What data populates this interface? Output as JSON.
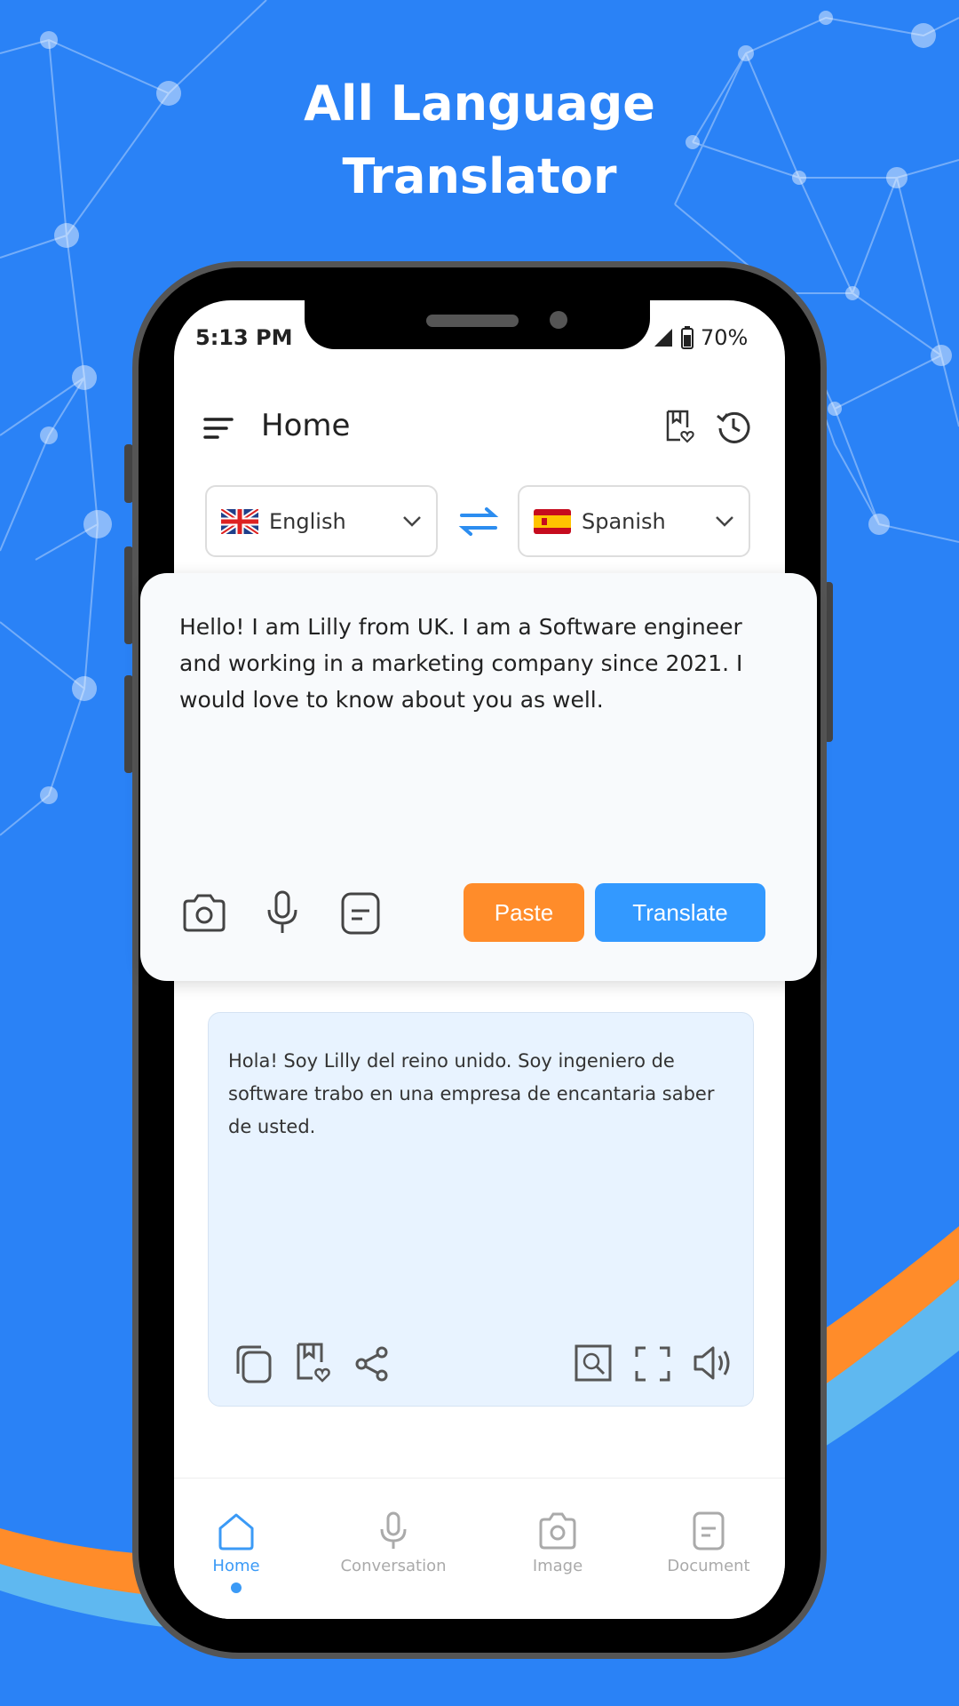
{
  "banner": {
    "title_line1": "All Language",
    "title_line2": "Translator"
  },
  "status_bar": {
    "time": "5:13 PM",
    "battery": "70%"
  },
  "header": {
    "title": "Home",
    "icons": [
      "menu-icon",
      "saved-icon",
      "history-icon"
    ]
  },
  "languages": {
    "source": "English",
    "target": "Spanish"
  },
  "input": {
    "text": "Hello! I am Lilly from UK. I am a Software engineer and working in a marketing company since 2021. I would love to know about you as well.",
    "paste_label": "Paste",
    "translate_label": "Translate"
  },
  "output": {
    "text": "Hola! Soy Lilly del reino unido. Soy ingeniero de software trabo en una empresa de encantaria saber de usted."
  },
  "nav": {
    "items": [
      {
        "label": "Home"
      },
      {
        "label": "Conversation"
      },
      {
        "label": "Image"
      },
      {
        "label": "Document"
      }
    ],
    "active": "Home"
  },
  "colors": {
    "background": "#2a82f6",
    "paste": "#ff8c2a",
    "translate": "#3399ff",
    "accent": "#3b9af6",
    "output_bg": "#e8f3ff"
  }
}
